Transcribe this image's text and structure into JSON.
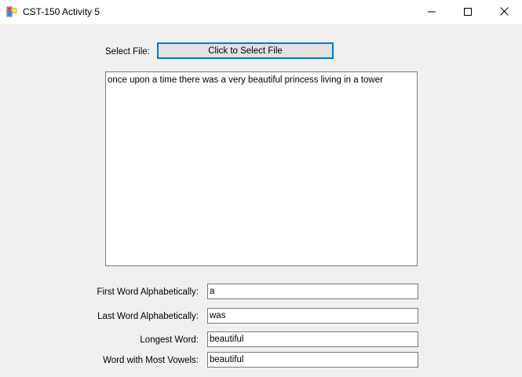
{
  "window": {
    "title": "CST-150 Activity 5",
    "controls": {
      "minimize": "minimize-icon",
      "maximize": "maximize-icon",
      "close": "close-icon"
    }
  },
  "file_select": {
    "label": "Select File:",
    "button_label": "Click to Select File"
  },
  "content": {
    "text": "once upon a time there was a very beautiful princess living in a tower"
  },
  "results": {
    "first_word": {
      "label": "First Word Alphabetically:",
      "value": "a"
    },
    "last_word": {
      "label": "Last Word Alphabetically:",
      "value": "was"
    },
    "longest_word": {
      "label": "Longest Word:",
      "value": "beautiful"
    },
    "most_vowels": {
      "label": "Word with Most Vowels:",
      "value": "beautiful"
    }
  },
  "colors": {
    "accent": "#0078d7",
    "background": "#f0f0f0",
    "button_face": "#e1e1e1",
    "border": "#7a7a7a"
  }
}
